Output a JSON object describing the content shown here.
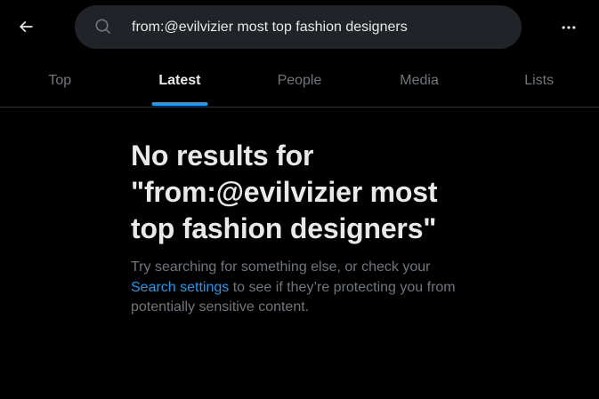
{
  "search": {
    "query": "from:@evilvizier most top fashion designers"
  },
  "tabs": [
    {
      "label": "Top",
      "active": false
    },
    {
      "label": "Latest",
      "active": true
    },
    {
      "label": "People",
      "active": false
    },
    {
      "label": "Media",
      "active": false
    },
    {
      "label": "Lists",
      "active": false
    }
  ],
  "empty_state": {
    "title": "No results for \"from:@evilvizier most top fashion designers\"",
    "text_before": "Try searching for something else, or check your ",
    "link_text": "Search settings",
    "text_after": " to see if they’re protecting you from potentially sensitive content."
  },
  "icons": {
    "back": "arrow-left-icon",
    "search": "search-icon",
    "more": "more-horizontal-icon"
  },
  "colors": {
    "background": "#000000",
    "search_bg": "#202327",
    "primary_text": "#e7e9ea",
    "secondary_text": "#71767b",
    "accent": "#1d9bf0",
    "divider": "#2f3336"
  }
}
